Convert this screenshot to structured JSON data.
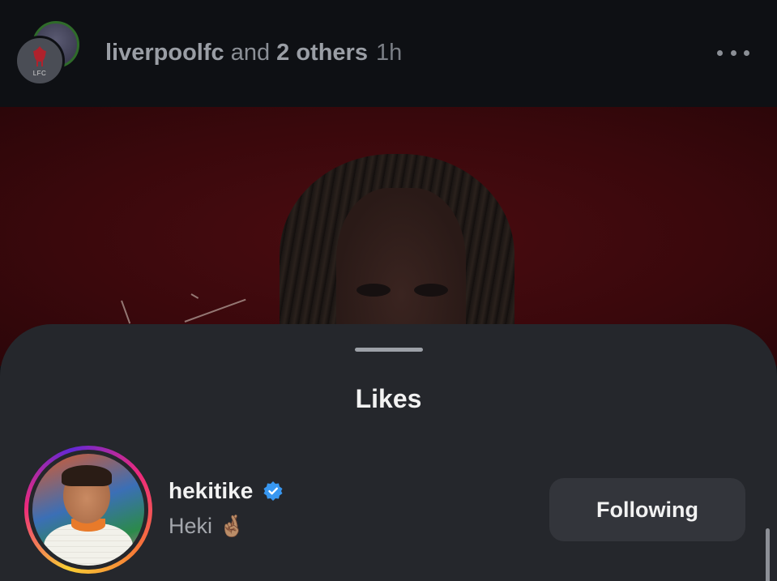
{
  "post": {
    "username": "liverpoolfc",
    "and_text": " and ",
    "others": "2 others",
    "time": "1h",
    "lfc_badge_text": "LFC",
    "icons": [
      "premier-league-avatar",
      "lfc-crest-icon",
      "more-options-icon"
    ]
  },
  "sheet": {
    "title": "Likes",
    "items": [
      {
        "username": "hekitike",
        "verified": true,
        "display_name": "Heki",
        "emoji": "🤞🏽",
        "button_label": "Following"
      }
    ]
  },
  "colors": {
    "background": "#0f1115",
    "sheet": "#25272c",
    "button": "#33353b",
    "verified": "#3897f0",
    "photo_red": "#4a0c10"
  }
}
